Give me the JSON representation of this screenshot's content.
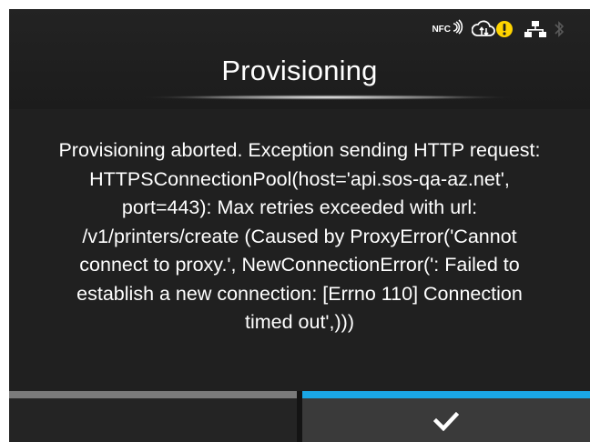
{
  "status_icons": [
    "nfc-icon",
    "cloud-sync-icon",
    "warning-icon",
    "network-icon",
    "bluetooth-icon"
  ],
  "status": {
    "nfc_label": "NFC"
  },
  "title": "Provisioning",
  "message": "Provisioning aborted. Exception sending HTTP request:\nHTTPSConnectionPool(host='api.sos-qa-az.net',\nport=443): Max retries exceeded with url:\n/v1/printers/create (Caused by ProxyError('Cannot\nconnect to proxy.', NewConnectionError(': Failed to\nestablish a new connection: [Errno 110] Connection\ntimed out',)))",
  "buttons": {
    "left": "",
    "right_icon": "checkmark-icon"
  },
  "colors": {
    "background": "#202020",
    "accent": "#1aa7e6",
    "warning": "#ffd400"
  }
}
